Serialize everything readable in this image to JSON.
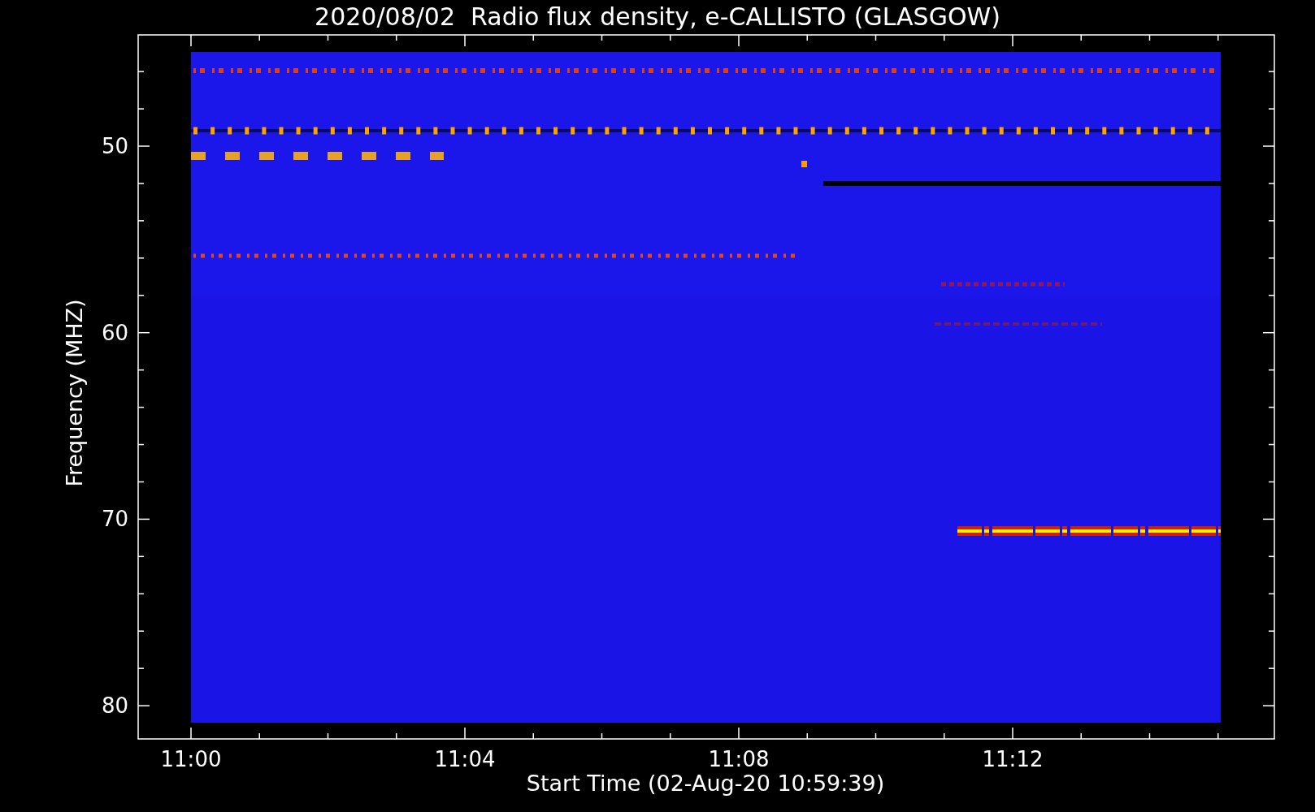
{
  "chart": {
    "title": "2020/08/02  Radio flux density, e-CALLISTO (GLASGOW)",
    "xlabel": "Start Time (02-Aug-20 10:59:39)",
    "ylabel": "Frequency (MHZ)",
    "xtick_labels": [
      "11:00",
      "11:04",
      "11:08",
      "11:12"
    ],
    "ytick_labels": [
      "50",
      "60",
      "70",
      "80"
    ]
  }
}
